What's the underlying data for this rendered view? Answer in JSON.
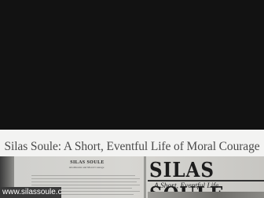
{
  "hero": {
    "color": "#121212"
  },
  "post": {
    "title": "Silas Soule: A Short, Eventful Life of Moral Courage"
  },
  "book_image": {
    "left_page_heading": "SILAS SOULE",
    "left_page_subtitle": "Abolitionist and Moral Courage",
    "cover_title": "SILAS SOULE",
    "cover_subtitle": "A Short, Eventful Life"
  },
  "watermark": {
    "domain": "www.silassoule.com"
  }
}
